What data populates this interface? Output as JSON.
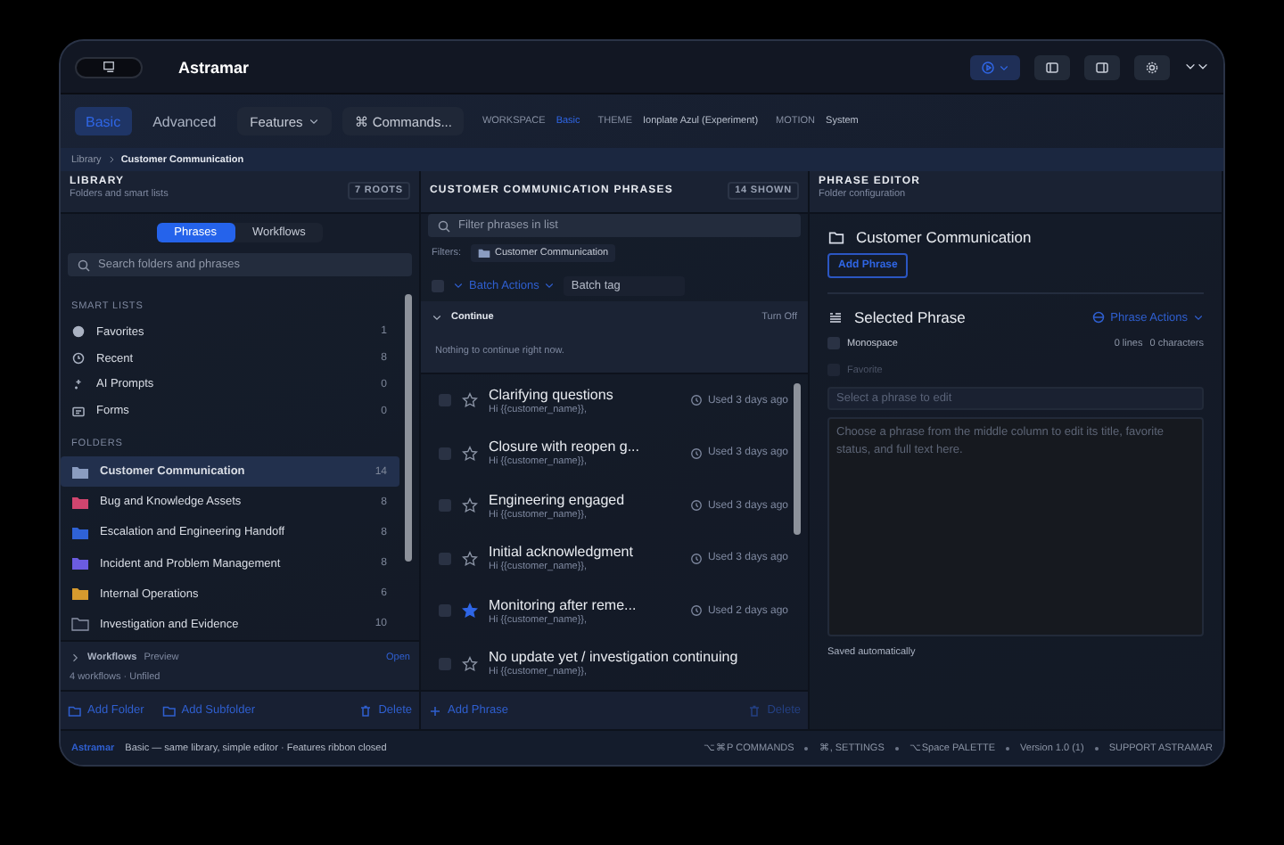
{
  "window": {
    "title": "Astramar"
  },
  "ribbon": {
    "modes": [
      {
        "label": "Basic",
        "selected": true
      },
      {
        "label": "Advanced",
        "selected": false
      }
    ],
    "buttons": [
      {
        "label": "Features",
        "kind": "menu"
      },
      {
        "label": "⌘ Commands...",
        "kind": "plain"
      }
    ],
    "info": [
      {
        "key": "WORKSPACE",
        "value": "Basic",
        "accent": true
      },
      {
        "key": "THEME",
        "value": "Ionplate Azul (Experiment)",
        "accent": false
      },
      {
        "key": "MOTION",
        "value": "System",
        "accent": false
      }
    ]
  },
  "breadcrumb": [
    "Library",
    "Customer Communication"
  ],
  "library": {
    "title": "LIBRARY",
    "subtitle": "Folders and smart lists",
    "badge": "7 ROOTS",
    "tabs": [
      {
        "label": "Phrases",
        "selected": true
      },
      {
        "label": "Workflows",
        "selected": false
      }
    ],
    "search": {
      "placeholder": "Search folders and phrases"
    },
    "smart_lists_label": "SMART LISTS",
    "smart_lists": [
      {
        "label": "Favorites",
        "count": "1",
        "kind": "favorites"
      },
      {
        "label": "Recent",
        "count": "8",
        "kind": "recent"
      },
      {
        "label": "AI Prompts",
        "count": "0",
        "kind": "ai"
      },
      {
        "label": "Forms",
        "count": "0",
        "kind": "forms"
      }
    ],
    "folders_label": "FOLDERS",
    "folders": [
      {
        "label": "Customer Communication",
        "count": "14",
        "color": "#8a9cc0",
        "selected": true
      },
      {
        "label": "Bug and Knowledge Assets",
        "count": "8",
        "color": "#d0456f",
        "selected": false
      },
      {
        "label": "Escalation and Engineering Handoff",
        "count": "8",
        "color": "#2f62d6",
        "selected": false
      },
      {
        "label": "Incident and Problem Management",
        "count": "8",
        "color": "#6b5ce0",
        "selected": false
      },
      {
        "label": "Internal Operations",
        "count": "6",
        "color": "#d69a2e",
        "selected": false
      },
      {
        "label": "Investigation and Evidence",
        "count": "10",
        "color": "#1b2232",
        "selected": false
      }
    ],
    "workflows": {
      "label": "Workflows",
      "tag": "Preview",
      "action": "Open",
      "summary": "4 workflows · Unfiled",
      "expanded": false
    },
    "actions": [
      "Add Folder",
      "Add Subfolder",
      "Delete"
    ]
  },
  "phrases": {
    "title": "CUSTOMER COMMUNICATION PHRASES",
    "badge": "14 SHOWN",
    "filter": {
      "placeholder": "Filter phrases in list"
    },
    "filters_label": "Filters:",
    "filter_chip": "Customer Communication",
    "select_all_checked": false,
    "batch_actions": "Batch Actions",
    "batch_tag": {
      "placeholder": "Batch tag"
    },
    "continue": {
      "label": "Continue",
      "action": "Turn Off",
      "empty": "Nothing to continue right now.",
      "expanded": true
    },
    "items": [
      {
        "title": "Clarifying questions",
        "preview": "Hi {{customer_name}},",
        "used": "Used 3 days ago",
        "favorite": false,
        "checked": false
      },
      {
        "title": "Closure with reopen g...",
        "preview": "Hi {{customer_name}},",
        "used": "Used 3 days ago",
        "favorite": false,
        "checked": false
      },
      {
        "title": "Engineering engaged",
        "preview": "Hi {{customer_name}},",
        "used": "Used 3 days ago",
        "favorite": false,
        "checked": false
      },
      {
        "title": "Initial acknowledgment",
        "preview": "Hi {{customer_name}},",
        "used": "Used 3 days ago",
        "favorite": false,
        "checked": false
      },
      {
        "title": "Monitoring after reme...",
        "preview": "Hi {{customer_name}},",
        "used": "Used 2 days ago",
        "favorite": true,
        "checked": false
      },
      {
        "title": "No update yet / investigation continuing",
        "preview": "Hi {{customer_name}},",
        "favorite": false,
        "checked": false
      }
    ],
    "actions": [
      "Add Phrase",
      "Delete"
    ]
  },
  "editor": {
    "title": "PHRASE EDITOR",
    "subtitle": "Folder configuration",
    "folder": "Customer Communication",
    "add_button": "Add Phrase",
    "section": "Selected Phrase",
    "phrase_actions": "Phrase Actions",
    "options": [
      {
        "label": "Monospace",
        "checked": false,
        "disabled": false
      },
      {
        "label": "Favorite",
        "checked": false,
        "disabled": true
      }
    ],
    "lines": "0 lines",
    "characters": "0 characters",
    "title_field": {
      "placeholder": "Select a phrase to edit"
    },
    "body_field": {
      "placeholder": "Choose a phrase from the middle column to edit its title, favorite status, and full text here."
    },
    "status": "Saved automatically"
  },
  "status_bar": {
    "brand": "Astramar",
    "message": "Basic — same library, simple editor · Features ribbon closed",
    "items": [
      "⌥⌘P COMMANDS",
      "⌘, SETTINGS",
      "⌥Space PALETTE",
      "Version 1.0 (1)",
      "SUPPORT ASTRAMAR"
    ]
  }
}
